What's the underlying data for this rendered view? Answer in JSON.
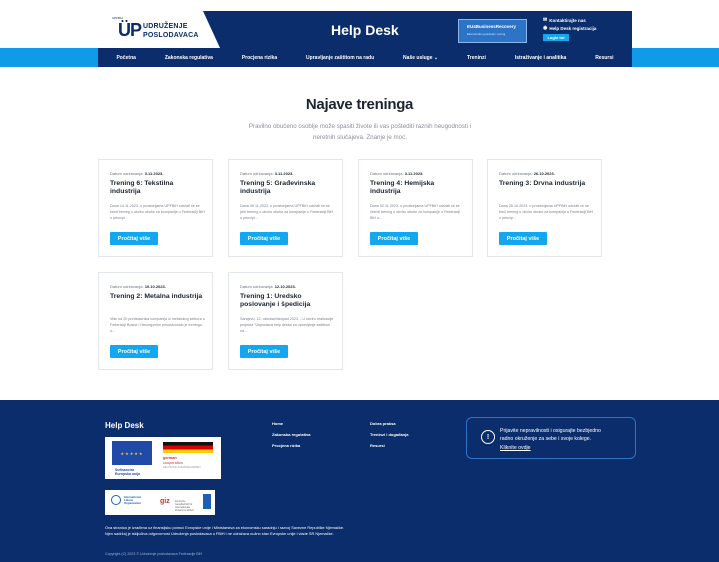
{
  "header": {
    "logo_mark": "ÜP",
    "logo_small": "UPFBiH",
    "logo_line1": "UDRUŽENJE",
    "logo_line2": "POSLODAVACA",
    "title": "Help Desk",
    "ebr_title": "EU4BusinessRecovery",
    "ebr_sub": "Ekonomski oporavak i razvoj",
    "login_label": "Login tut",
    "contact_label": "Kontaktirajte nas",
    "register_label": "Help Desk registracija"
  },
  "nav": {
    "items": [
      {
        "label": "Početna"
      },
      {
        "label": "Zakonska regulativa"
      },
      {
        "label": "Procjena rizika"
      },
      {
        "label": "Upravljanje zaštitom na radu"
      },
      {
        "label": "Naše usluge ⌄"
      },
      {
        "label": "Treninzi"
      },
      {
        "label": "Istraživanje i analitika"
      },
      {
        "label": "Resursi"
      }
    ]
  },
  "main": {
    "title": "Najave treninga",
    "subtitle": "Pravilno obučeno osoblje može spasiti živote ili vas poštediti raznih neugodnosti i neretnih slučajeva. Znanje je moć."
  },
  "cards": [
    {
      "date_label": "Datum održavanja:",
      "date": "3.11.2023.",
      "title": "Trening 6: Tekstilna industrija",
      "text": "Dana 14.11.2023. u prostorijama UPFBiH održati će se šesti trening u okviru obuke za kompanije u Federaciji BiH o principi...",
      "button": "Pročitaj više"
    },
    {
      "date_label": "Datum održavanja:",
      "date": "3.11.2023.",
      "title": "Trening 5: Građevinska industrija",
      "text": "Dana 09.11.2023. u prostorijama UPFBiH održati će se peti trening u okviru obuke za kompanije u Federaciji BiH o principi...",
      "button": "Pročitaj više"
    },
    {
      "date_label": "Datum održavanja:",
      "date": "3.11.2023.",
      "title": "Trening 4: Hemijska industrija",
      "text": "Dana 02.11.2023. u prostorijama UPFBiH održati će se četvrti trening u okviru obuke za kompanije u Federaciji BiH o...",
      "button": "Pročitaj više"
    },
    {
      "date_label": "Datum održavanja:",
      "date": "26.10.2023.",
      "title": "Trening 3: Drvna industrija",
      "text": "Dana 26.10.2023. u prostorijama UPFBiH održati će se treći trening u okviru obuke za kompanije u Federaciji BiH o princip...",
      "button": "Pročitaj više"
    },
    {
      "date_label": "Datum održavanja:",
      "date": "19.10.2023.",
      "title": "Trening 2: Metalna industrija",
      "text": "Više od 20 predstavnika kompanija iz metalskog sektora u Federaciji Bosne i Hercegovine prisustvovalo je treningu o...",
      "button": "Pročitaj više"
    },
    {
      "date_label": "Datum održavanja:",
      "date": "12.10.2023.",
      "title": "Trening 1: Uredsko poslovanje i špedicija",
      "text": "Sarajevo, 12. oktobar/listopad 2023. - U okviru realizacije projekta \"Uspostava help deska za upravljanje zaštitom na...",
      "button": "Pročitaj više"
    }
  ],
  "footer": {
    "title": "Help Desk",
    "eu_line1": "Sufinancira",
    "eu_line2": "Europska unija",
    "ger_line1": "german",
    "ger_line2": "cooperation",
    "ger_line3": "DEUTSCHE ZUSAMMENARBEIT",
    "ilo_text": "International Labour Organization",
    "giz_text": "giz",
    "giz_sub": "Deutsche Gesellschaft für Internationale Zusammenarbeit",
    "col1": [
      "Home",
      "Zakonska regulativa",
      "Procjena rizika"
    ],
    "col2": [
      "Dobra praksa",
      "Treninzi i događanja",
      "Resursi"
    ],
    "report_line1": "Prijavite nepravilnosti i osigurajte bezbjedno",
    "report_line2": "radno okruženje za sebe i svoje kolege.",
    "report_link": "Kliknite ovdje",
    "disclaimer": "Ova stranica je izrađena uz finansijsku pomoć Evropske unije i Ministarstva za ekonomsku saradnju i razvoj Savezne Republike Njemačke. Njen sadržaj je isključiva odgovornost Udruženja poslodavaca u FBiH i ne odražava nužno stav Evropske unije i vlade SR Njemačke.",
    "copyright": "Copyright (C) 2023 © Udruženje poslodavaca Federacije BiH"
  }
}
